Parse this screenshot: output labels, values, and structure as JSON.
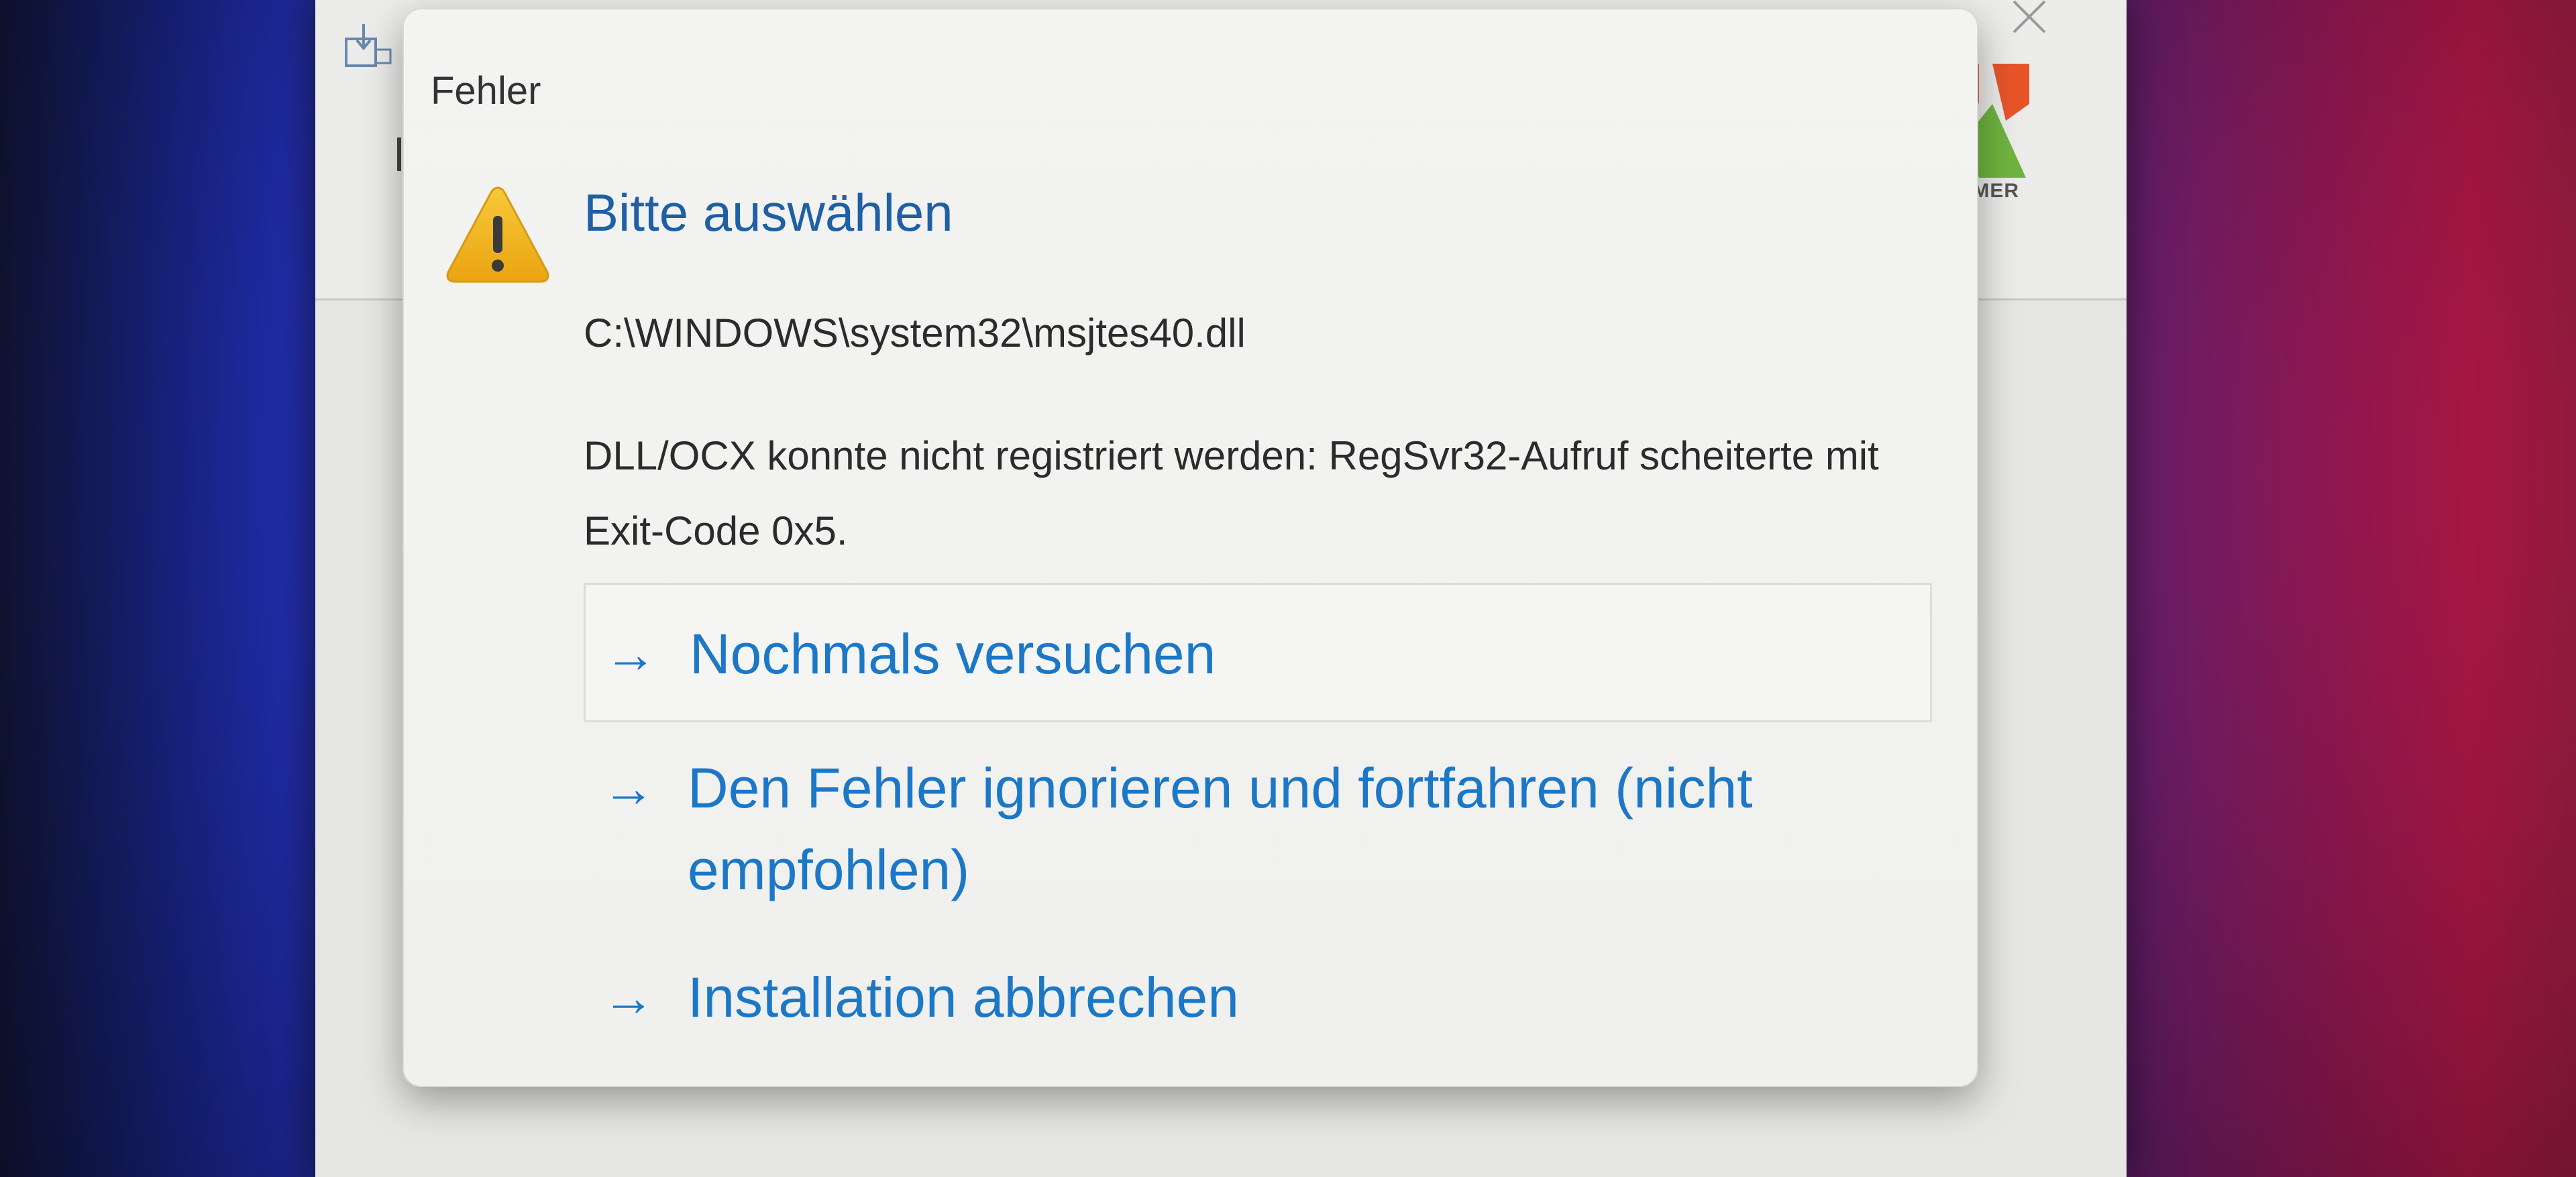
{
  "installer": {
    "logo_text": "EIMER"
  },
  "dialog": {
    "title": "Fehler",
    "main_instruction": "Bitte auswählen",
    "file_path": "C:\\WINDOWS\\system32\\msjtes40.dll",
    "error_message": "DLL/OCX konnte nicht registriert werden: RegSvr32-Aufruf scheiterte mit Exit-Code 0x5.",
    "commands": [
      {
        "arrow": "→",
        "label": "Nochmals versuchen"
      },
      {
        "arrow": "→",
        "label": "Den Fehler ignorieren und fortfahren (nicht empfohlen)"
      },
      {
        "arrow": "→",
        "label": "Installation abbrechen"
      }
    ]
  },
  "icons": {
    "warning": "warning-icon",
    "installer_app": "installer-icon",
    "close": "close-icon",
    "logo": "logo-icon"
  },
  "colors": {
    "link_blue": "#1c78c7",
    "instruction_blue": "#1e5fa6",
    "warning_yellow": "#f2b320"
  }
}
